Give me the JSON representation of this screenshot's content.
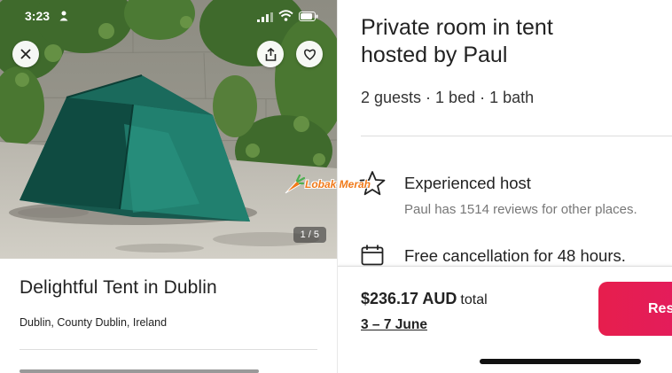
{
  "status_bar": {
    "time": "3:23"
  },
  "photo": {
    "counter": "1 / 5"
  },
  "listing": {
    "title": "Delightful Tent in Dublin",
    "location": "Dublin, County Dublin, Ireland"
  },
  "room": {
    "title_line1": "Private room in tent",
    "title_line2": "hosted by Paul",
    "summary": "2 guests · 1 bed · 1 bath"
  },
  "highlights": [
    {
      "icon": "star-icon",
      "title": "Experienced host",
      "subtitle": "Paul has 1514 reviews for other places."
    },
    {
      "icon": "calendar-icon",
      "title": "Free cancellation for 48 hours."
    }
  ],
  "booking": {
    "price": "$236.17 AUD",
    "price_suffix": "total",
    "dates": "3 – 7 June",
    "reserve_label": "Res"
  },
  "watermark": {
    "text": "Lobak Merah"
  },
  "colors": {
    "accent": "#e31c5f",
    "tent": "#1e6b5e",
    "watermark": "#f07a1a"
  }
}
